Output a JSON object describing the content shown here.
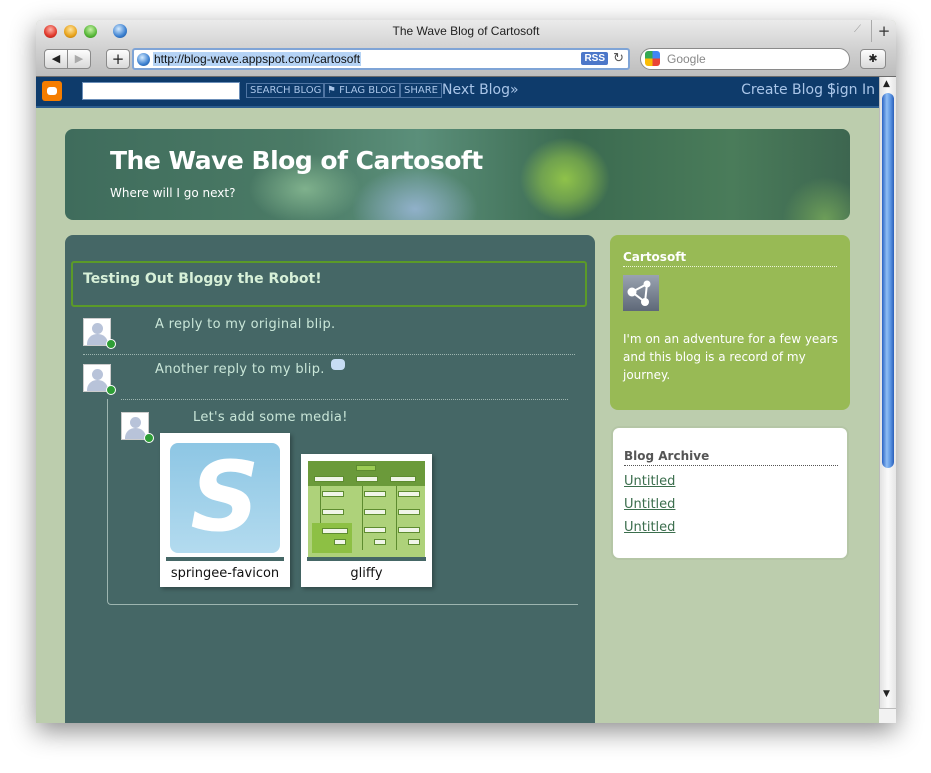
{
  "window": {
    "title": "The Wave Blog of Cartosoft",
    "url": "http://blog-wave.appspot.com/cartosoft",
    "rss_label": "RSS",
    "search_placeholder": "Google",
    "new_tab_label": "+"
  },
  "navbar": {
    "search_blog": "SEARCH BLOG",
    "flag_blog": "FLAG BLOG",
    "share": "SHARE",
    "next_blog": "Next Blog»",
    "create_blog": "Create Blog",
    "separator": "|",
    "sign_in": "Sign In"
  },
  "header": {
    "title": "The Wave Blog of Cartosoft",
    "description": "Where will I go next?"
  },
  "post": {
    "title": "Testing Out Bloggy the Robot!",
    "blips": [
      {
        "text": "A reply to my original blip."
      },
      {
        "text": "Another reply to my blip."
      },
      {
        "text": "Let's add some media!"
      }
    ],
    "media": [
      {
        "caption": "springee-favicon",
        "glyph": "S"
      },
      {
        "caption": "gliffy"
      }
    ]
  },
  "sidebar": {
    "profile": {
      "heading": "Cartosoft",
      "about": "I'm on an adventure for a few years and this blog is a record of my journey."
    },
    "archive": {
      "heading": "Blog Archive",
      "links": [
        "Untitled",
        "Untitled",
        "Untitled"
      ]
    }
  },
  "colors": {
    "page_bg": "#bccdad",
    "main_column": "#456766",
    "profile_widget": "#98ba55",
    "navbar": "#0e3b6b",
    "post_border": "#5b9a28",
    "online": "#2e9e36"
  }
}
